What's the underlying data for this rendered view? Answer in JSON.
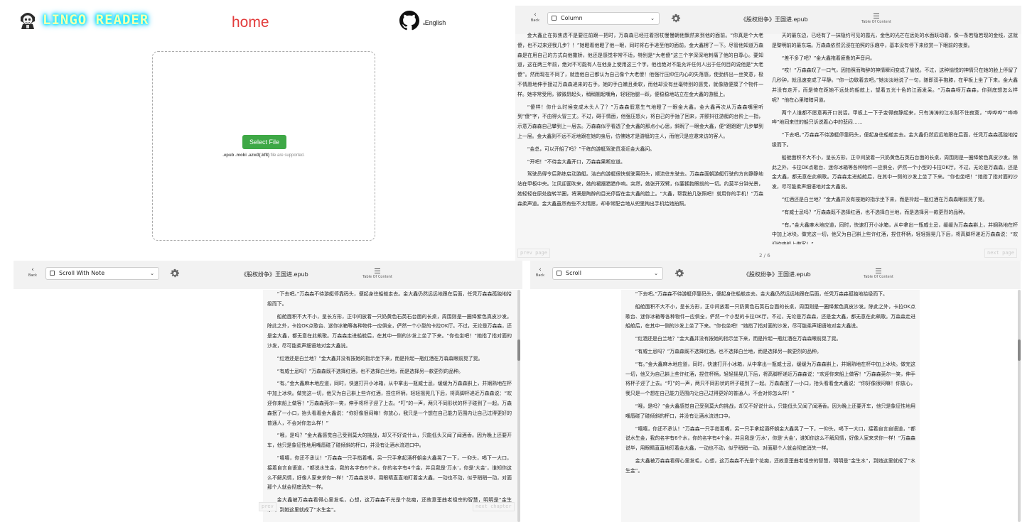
{
  "home": {
    "logo_text": "LINGO READER",
    "title": "home",
    "language": "English",
    "select_file": "Select File",
    "supported_formats": ".epub .mobi .azw3(.kf8)",
    "supported_suffix": "file are supported."
  },
  "reader_common": {
    "back_label": "Back",
    "book_title": "《股权纷争》王国进.epub",
    "toc_label": "Table Of Content"
  },
  "column_reader": {
    "mode": "Column",
    "prev_page": "prev page",
    "next_page": "next page",
    "page_indicator": "2 / 6",
    "left_paragraphs": [
      "金大鑫止在拟焦虑不是要往前跟一把时，万森森已经拄着拐杖慢慢朝他飘然来到他的面前。“你真是个大老傻，也不过来迎我几步？！”她瞪着他瞪了他一眼，同时将右手递至他的面前。金大鑫楞了一下。尽管他知道万森森是在用自己的方式向他撒娇，他还是感觉非常不适，特别是“大老傻”这三个字深深地刺痛了他的自尊心。要知道，这在两三年前，绝对不可能有人在他身上使用这三个字。他也绝对不能允许任何人出于任何目的说他是“大老傻”。然而现在不同了，就连他自己都认为自己像个大老傻！他强行压抑住内心的失落感，使劲挤出一丝笑意，极不情愿地伸手接过万森森递来的右手。她的手白嫩且柔软，而他却没有丝毫特别的感觉，就像随便摸了个物件一样。她非常受用，微微昂起头，稍稍翘起嘴角，轻轻抬腿一跃，便稳稳地站立在金大鑫的游艇上。",
      "“傻样！你什么时候变成木头人了？”万森森假意生气地瞪了一眼金大鑫。金大鑫再次从万森森嘴里听到“傻”字，不由得火冒三丈。不过，碍于情面，他强压怒火，将自己的手抽了回来，并颤抖往游艇的台阶上一指，示意万森森自己攀到上一层去。万森森似乎看透了金大鑫的那点小心思，斜睨了一眼金大鑫，便“蹬蹬蹬”几步攀到上一层。金大鑫则不远不近地跟在她的身后，仿佛她才是游艇的主人，而他只是应邀来访的客人。",
      "“金总，可以开船了吗？”干练的游艇驾驶员凑近金大鑫问。",
      "“开吧！”不待金大鑫开口，万森森果断应道。",
      "驾驶员得令后熟练启动游艇。洁白的游艇很快就驶离码头，顺流往东驶去。万森森面朝游艇行驶的方向静静地站在甲板中央。江风迎面吹来，她的裙摆猎猎作响。突然，她张开双臂，似要拥抱眼前的一切。约莫半分钟光景，她轻轻在原处旋转半圈，将满是陶醉的目光停留在金大鑫的脸上。“大鑫，帮我拍几张照吧！就用你的手机！”万森森柔声道。金大鑫虽然有些不太情愿，却非常配合地从兜里掏出手机给她拍照。"
    ],
    "right_paragraphs": [
      "天的最东边，已经有了一抹隐约可见的霞光，金色的光芒在远处的水面跃动着，像一条若隐若现的金线，这就是黎明前的最东端。万森森依然沉浸在拍照的乐趣中，基本没有停下来欣赏一下眼前的夜景。",
      "“差不多了吧？”金大鑫拖着疲惫的声音问。",
      "“哎！”万森森叹了一口气，因拍照而陶醉的神情瞬间变成了愉悦。不过，这种愉悦的神情只在她的脸上停留了几秒钟，就迅速变成了平静。“你一边歇着去吧。”她淡淡地说了一句，随即双手抱膝，在甲板上坐了下来。金大鑫并没有走开，而是倚在距她不远处的船舷上，望着五光十色的江面发呆。“万森森呀万森森，你到底想怎么样呢？”他在心里暗暗问道。",
      "两个人谁都不愿意再开口说话。甲板上一下子变得寂静起来，只有涛涛的江水耐不住寂寞，“哗哗哗”“哗哗哗”地同来往的船只诉说着心中的悲闷……",
      "“下去吧。”万森森不待游艇停靠码头，便起身往船舱走去。金大鑫仍然远远地跟在后面，任凭万森森孤独地拾级而下。",
      "船舱面积不大不小，呈长方形，正中间放着一只奶黄色石英石台面的长桌，周围则是一圈绛紫色真皮沙发。除此之外，卡拉OK点歌台、迷你冰箱等各种物件一应俱全，俨然一个小型的卡拉OK厅。不过，无论是万森森，还是金大鑫，都无意在此飙歌。万森森走进船舱后，在其中一侧的沙发上坐了下来。“你也坐吧！”她指了指对面的沙发，尽可能柔声细语地对金大鑫说。",
      "“红酒还是白兰地？”金大鑫并没有按她的指示坐下来，而是拎起一瓶红酒在万森森眼前晃了晃。",
      "“有威士忌吗？”万森森既不选择红酒，也不选择白兰地，而是选择另一款更烈的品种。",
      "“有。”金大鑫麻木地应道，同时，快速打开小冰箱，从中拿出一瓶威士忌，缓缓为万森森斟上，并娴熟地在杯中加上冰块。做完这一切，他又为自己斟上些许红酒，捏住杯柄，轻轻摇晃几下后，将高脚杯递近万森森说：“欢迎你来船上做客！”"
    ]
  },
  "scroll_with_note": {
    "mode": "Scroll With Note",
    "prev_chapter": "prev",
    "next_chapter": "next chapter"
  },
  "scroll_reader": {
    "mode": "Scroll"
  },
  "scroll_paragraphs": [
    "“下去吧。”万森森不待游艇停靠码头，便起身往船舱走去。金大鑫仍然远远地跟在后面，任凭万森森孤独地拾级而下。",
    "船舱面积不大不小，呈长方形，正中间放着一只奶黄色石英石台面的长桌，周围则是一圈绛紫色真皮沙发。除此之外，卡拉OK点歌台、迷你冰箱等各种物件一应俱全，俨然一个小型的卡拉OK厅。不过，无论是万森森，还是金大鑫，都无意在此飙歌。万森森走进船舱后，在其中一侧的沙发上坐了下来。“你也坐吧！”她指了指对面的沙发，尽可能柔声细语地对金大鑫说。",
    "“红酒还是白兰地？”金大鑫并没有按她的指示坐下来，而是拎起一瓶红酒在万森森眼前晃了晃。",
    "“有威士忌吗？”万森森既不选择红酒，也不选择白兰地，而是选择另一款更烈的品种。",
    "“有。”金大鑫麻木地应道，同时，快速打开小冰箱，从中拿出一瓶威士忌，缓缓为万森森斟上，并娴熟地在杯中加上冰块。做完这一切，他又为自己斟上些许红酒，捏住杯柄，轻轻摇晃几下后，将高脚杯递近万森森说：“欢迎你来船上做客！”万森森莞尔一笑，伸手将杯子迎了上去。“叮”的一声，两只不同形状的杯子碰到了一起。万森森抿了一小口，抬头看着金大鑫说：“你好像很闷嘛！你放心，我只是一个想在自己能力范围内让自己过得更好的普通人，不会对你怎么样！”",
    "“哦，是吗？”金大鑫感觉自己受到莫大的挑战，却又不好说什么，只能低头又闻了闻酒香。因为晚上还要开车，他只是象征性地用嘴唇碰了碰倾斜的杯口，并没有让酒水流进口中。",
    "“嘻嘻，你还不承认！”万森森一只手指着嘴，另一只手拿起酒杯朝金大鑫晃了一下，一仰头，喝下一大口，接着自言自语道，“都说水生金，我的名字有6个水，你的名字有4个金，并且我是‘万水’，你是‘大金’，谁知你这么不解风情，好像人家来求你一样！”万森森说毕，用眼睛直直地盯着金大鑫，一动也不动，似乎稍稍一动，对面那个人就会彻底消失一样。",
    "金大鑫被万森森看得心里发毛，心想，这万森森不光是个花痴，还故意歪曲老祖宗的智慧，明明是“金生水”，到她这里就成了“水生金”。"
  ]
}
